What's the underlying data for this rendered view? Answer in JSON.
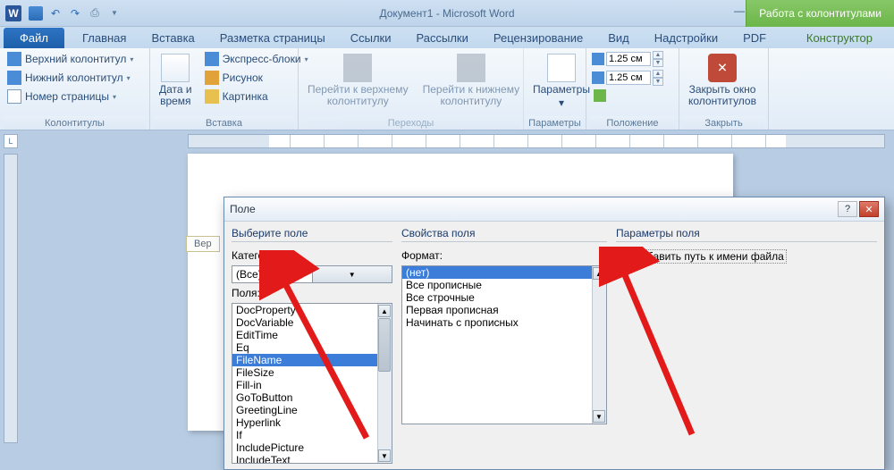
{
  "titlebar": {
    "app_letter": "W",
    "title": "Документ1 - Microsoft Word",
    "tool_tab": "Работа с колонтитулами"
  },
  "tabs": {
    "file": "Файл",
    "items": [
      "Главная",
      "Вставка",
      "Разметка страницы",
      "Ссылки",
      "Рассылки",
      "Рецензирование",
      "Вид",
      "Надстройки",
      "PDF"
    ],
    "context": "Конструктор"
  },
  "ribbon": {
    "g1": {
      "label": "Колонтитулы",
      "b1": "Верхний колонтитул",
      "b2": "Нижний колонтитул",
      "b3": "Номер страницы"
    },
    "g2": {
      "label": "Вставка",
      "big": "Дата и\nвремя",
      "b1": "Экспресс-блоки",
      "b2": "Рисунок",
      "b3": "Картинка"
    },
    "g3": {
      "label": "Переходы",
      "b1": "Перейти к верхнему\nколонтитулу",
      "b2": "Перейти к нижнему\nколонтитулу"
    },
    "g4": {
      "label": "Параметры",
      "big": "Параметры"
    },
    "g5": {
      "label": "Положение",
      "v1": "1.25 см",
      "v2": "1.25 см"
    },
    "g6": {
      "label": "Закрыть",
      "big": "Закрыть окно\nколонтитулов"
    }
  },
  "doc": {
    "header_tab": "Вер"
  },
  "dialog": {
    "title": "Поле",
    "col1": {
      "heading": "Выберите поле",
      "cat_label": "Категории:",
      "cat_value": "(Все)",
      "fields_label": "Поля:",
      "fields": [
        "DocProperty",
        "DocVariable",
        "EditTime",
        "Eq",
        "FileName",
        "FileSize",
        "Fill-in",
        "GoToButton",
        "GreetingLine",
        "Hyperlink",
        "If",
        "IncludePicture",
        "IncludeText"
      ],
      "selected": "FileName"
    },
    "col2": {
      "heading": "Свойства поля",
      "format_label": "Формат:",
      "formats": [
        "(нет)",
        "Все прописные",
        "Все строчные",
        "Первая прописная",
        "Начинать с прописных"
      ],
      "selected": "(нет)"
    },
    "col3": {
      "heading": "Параметры поля",
      "opt1": "Добавить путь к имени файла",
      "opt1_checked": true
    }
  }
}
